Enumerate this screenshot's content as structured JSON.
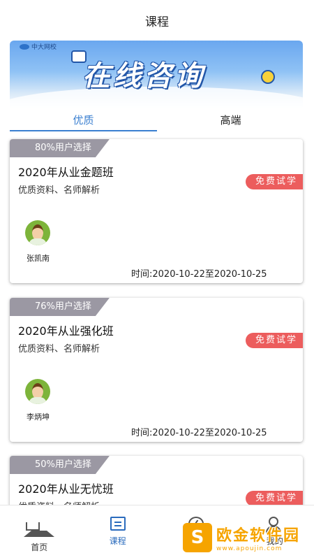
{
  "header": {
    "title": "课程"
  },
  "banner": {
    "brand": "中大网校",
    "headline": "在线咨询"
  },
  "tabs": [
    {
      "label": "优质",
      "active": true
    },
    {
      "label": "高端",
      "active": false
    }
  ],
  "courses": [
    {
      "badge": "80%用户选择",
      "title": "2020年从业金题班",
      "subtitle": "优质资料、名师解析",
      "trial": "免费试学",
      "teacher": "张凯南",
      "time": "时间:2020-10-22至2020-10-25"
    },
    {
      "badge": "76%用户选择",
      "title": "2020年从业强化班",
      "subtitle": "优质资料、名师解析",
      "trial": "免费试学",
      "teacher": "李炳坤",
      "time": "时间:2020-10-22至2020-10-25"
    },
    {
      "badge": "50%用户选择",
      "title": "2020年从业无忧班",
      "subtitle": "优质资料、名师解析",
      "trial": "免费试学"
    }
  ],
  "nav": [
    {
      "label": "首页",
      "icon": "home-icon",
      "active": false
    },
    {
      "label": "课程",
      "icon": "course-icon",
      "active": true
    },
    {
      "label": "发现",
      "icon": "discover-icon",
      "active": false
    },
    {
      "label": "我的",
      "icon": "me-icon",
      "active": false
    }
  ],
  "watermark": {
    "name": "欧金软件园",
    "site": "www.apoujin.com"
  },
  "colors": {
    "accent": "#3a7fd0",
    "trial": "#ec5d5d",
    "badge": "#9b98a3",
    "watermark": "#f6a400"
  }
}
